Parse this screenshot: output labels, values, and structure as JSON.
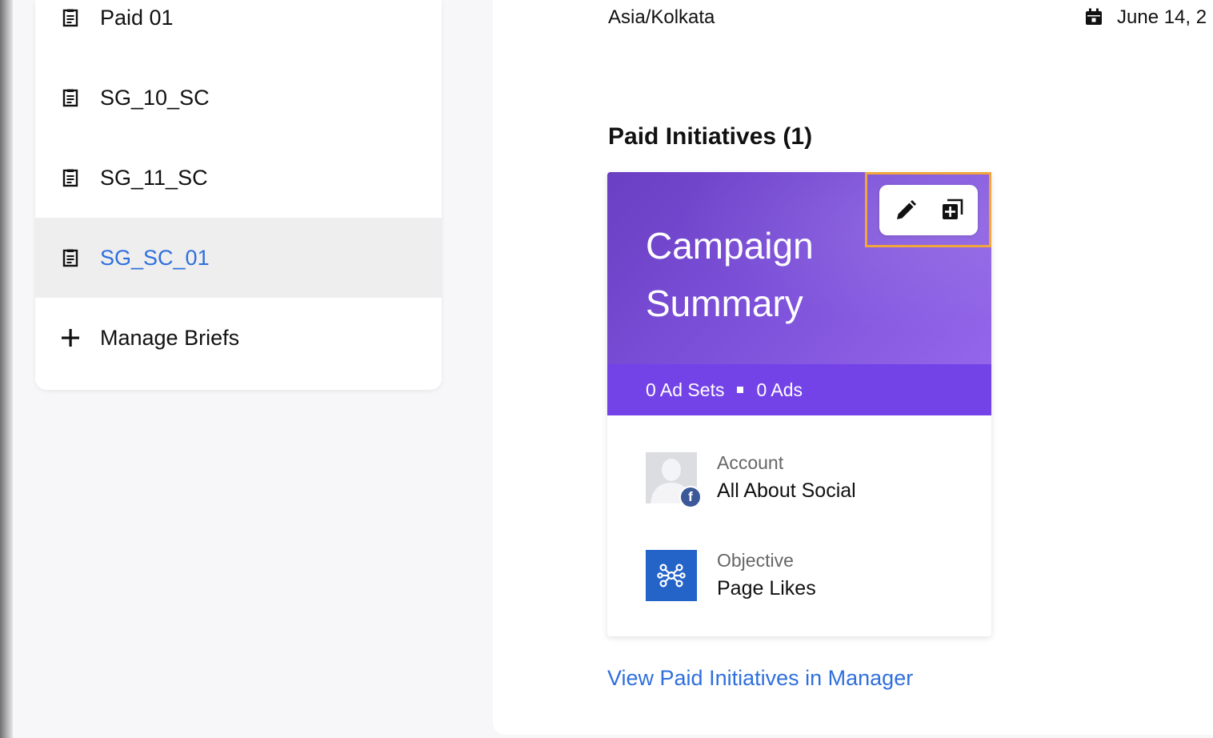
{
  "briefs": {
    "items": [
      {
        "label": "Paid 01",
        "icon": "clipboard-icon"
      },
      {
        "label": "SG_10_SC",
        "icon": "clipboard-icon"
      },
      {
        "label": "SG_11_SC",
        "icon": "clipboard-icon"
      },
      {
        "label": "SG_SC_01",
        "icon": "clipboard-icon",
        "selected": true
      }
    ],
    "manage_label": "Manage Briefs",
    "manage_icon": "plus-icon"
  },
  "header": {
    "timezone": "Asia/Kolkata",
    "date": "June 14, 2",
    "date_icon": "calendar-icon"
  },
  "paid_initiatives": {
    "title": "Paid Initiatives (1)",
    "card": {
      "title": "Campaign Summary",
      "ad_sets": "0 Ad Sets",
      "ads": "0 Ads",
      "actions": {
        "edit_icon": "pencil-icon",
        "duplicate_icon": "duplicate-icon"
      },
      "account_label": "Account",
      "account_value": "All About Social",
      "account_badge": "f",
      "objective_label": "Objective",
      "objective_value": "Page Likes",
      "objective_icon": "network-icon"
    },
    "link_label": "View Paid Initiatives in Manager"
  },
  "colors": {
    "accent_link": "#2f6fdd",
    "card_gradient_start": "#6a3fc2",
    "card_gradient_end": "#9466ea",
    "card_counts_bar": "#7443e8",
    "highlight": "#f0a63b",
    "facebook": "#3b5998",
    "objective_tile": "#2463c8"
  }
}
